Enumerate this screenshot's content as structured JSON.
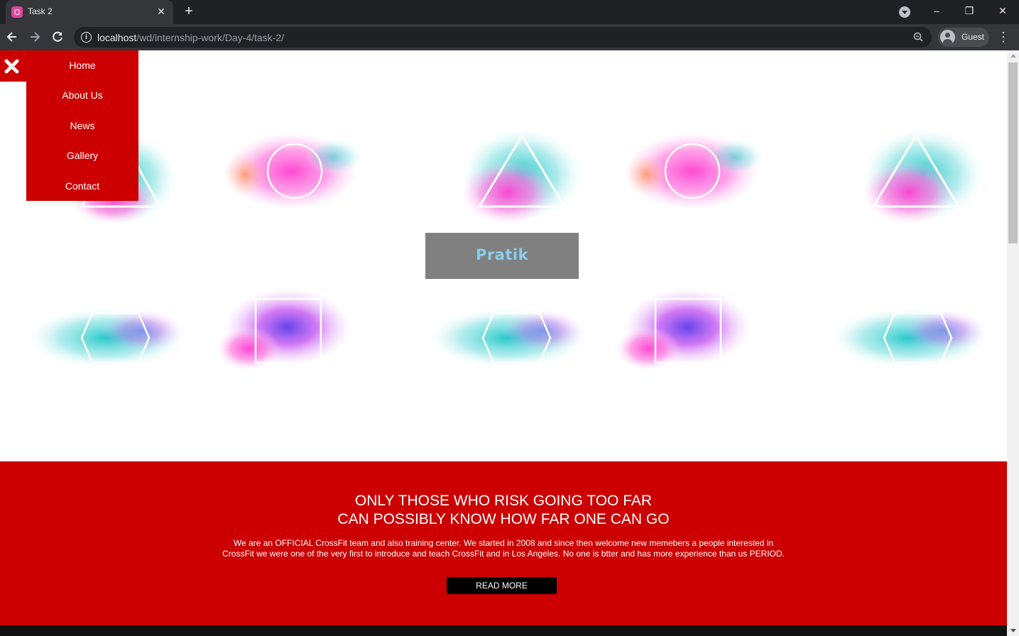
{
  "browser": {
    "tab_title": "Task 2",
    "tab_close": "✕",
    "new_tab": "+",
    "url_host": "localhost",
    "url_path": "/wd/internship-work/Day-4/task-2/",
    "profile_label": "Guest",
    "window_controls": [
      "–",
      "❐",
      "✕"
    ]
  },
  "menu": {
    "items": [
      "Home",
      "About Us",
      "News",
      "Gallery",
      "Contact"
    ]
  },
  "logo": {
    "text": "Pratik"
  },
  "promo": {
    "heading_line1": "ONLY THOSE WHO RISK GOING TOO FAR",
    "heading_line2": "CAN POSSIBLY KNOW HOW FAR ONE CAN GO",
    "text_line1": "We are an OFFICIAL CrossFit team and also training center. We started in 2008 and since then welcome new memebers a people interested in",
    "text_line2": "CrossFit we were one of the very first to introduce and teach CrossFit and in Los Angeles. No one is btter and has more experience than us PERIOD.",
    "button_label": "READ MORE"
  },
  "colors": {
    "accent_red": "#cc0000",
    "logo_box": "#808080",
    "logo_text": "#87ceeb",
    "chrome_bg": "#202124"
  },
  "icons": [
    "tab-favicon-icon",
    "close-tab-icon",
    "new-tab-icon",
    "back-icon",
    "forward-icon",
    "reload-icon",
    "info-icon",
    "zoom-icon",
    "profile-icon",
    "menu-dots-icon",
    "close-icon"
  ]
}
